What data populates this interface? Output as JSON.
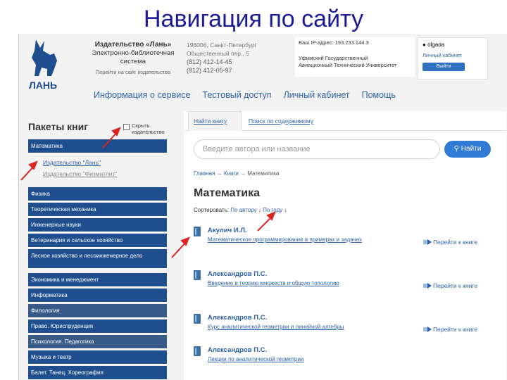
{
  "slide_title": "Навигация по сайту",
  "colors": {
    "nav_blue": "#1f4e8f",
    "link": "#2b62a8",
    "button": "#2f7bd6",
    "arrow_red": "#dd2222"
  },
  "header": {
    "brand_line1": "Издательство «Лань»",
    "brand_line2": "Электронно-библиотечная",
    "brand_line3": "система",
    "brand_key": "Перейти на сайт издательства",
    "city": "196006, Санкт-Петербург",
    "street": "Общественный пер., 5",
    "phone1": "(812) 412-14-45",
    "phone2": "(812) 412-05-97",
    "ip_label": "Ваш IP-адрес: 193.233.144.3",
    "org_line1": "Уфимский Государственный",
    "org_line2": "Авиационный Технический Университет",
    "username": "olgaoa",
    "cabinet_link": "Личный кабинет",
    "exit_btn": "Выйти"
  },
  "nav": [
    "Информация о сервисе",
    "Тестовый доступ",
    "Личный кабинет",
    "Помощь"
  ],
  "left": {
    "title": "Пакеты книг",
    "hide_label": "Скрыть издательство",
    "selected_category": "Математика",
    "publishers": [
      "Издательство \"Лань\"",
      "Издательство \"Физматлит\""
    ],
    "categories": [
      "Физика",
      "Теоретическая механика",
      "Инженерные науки",
      "Ветеринария и сельское хозяйство",
      "Лесное хозяйство и лесоинженерное дело",
      "Экономика и менеджмент",
      "Информатика",
      "Филология",
      "Право. Юриспруденция",
      "Психология. Педагогика",
      "Музыка и театр",
      "Балет. Танец. Хореография"
    ]
  },
  "right": {
    "tab1": "Найти книгу",
    "tab2": "Поиск по содержимому",
    "search_placeholder": "Введите автора или название",
    "search_btn": "Найти",
    "breadcrumb_home": "Главная",
    "breadcrumb_books": "Книги",
    "breadcrumb_current": "Математика",
    "page_title": "Математика",
    "sort_label": "Сортировать:",
    "sort_author": "По автору",
    "sort_year": "По году",
    "go_label": "Перейти к книге",
    "books": [
      {
        "author": "Акулич И.Л.",
        "title": "Математическое программирование в примерах и задачах"
      },
      {
        "author": "Александров П.С.",
        "title": "Введение в теорию множеств и общую топологию"
      },
      {
        "author": "Александров П.С.",
        "title": "Курс аналитической геометрии и линейной алгебры"
      },
      {
        "author": "Александров П.С.",
        "title": "Лекции по аналитической геометрии"
      }
    ]
  }
}
